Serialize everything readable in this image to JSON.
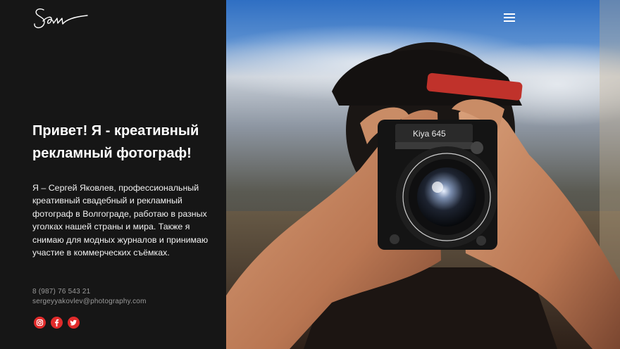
{
  "logo": {
    "text": "Sam"
  },
  "hero": {
    "headline": "Привет! Я - креативный рекламный фотограф!",
    "bio": "Я – Сергей Яковлев, профессиональный креативный свадебный и рекламный фотограф в Волгограде, работаю в разных уголках нашей страны и мира. Также я снимаю для модных журналов и принимаю участие в коммерческих съёмках."
  },
  "contacts": {
    "phone": "8 (987) 76 543 21",
    "email": "sergeyyakovlev@photography.com"
  },
  "socials": [
    {
      "icon": "instagram-icon"
    },
    {
      "icon": "facebook-icon"
    },
    {
      "icon": "twitter-icon"
    }
  ],
  "colors": {
    "sidebar_bg": "#161616",
    "accent": "#e02b2b",
    "text_muted": "#9a9a9a"
  },
  "menu": {
    "icon": "hamburger-menu-icon"
  }
}
